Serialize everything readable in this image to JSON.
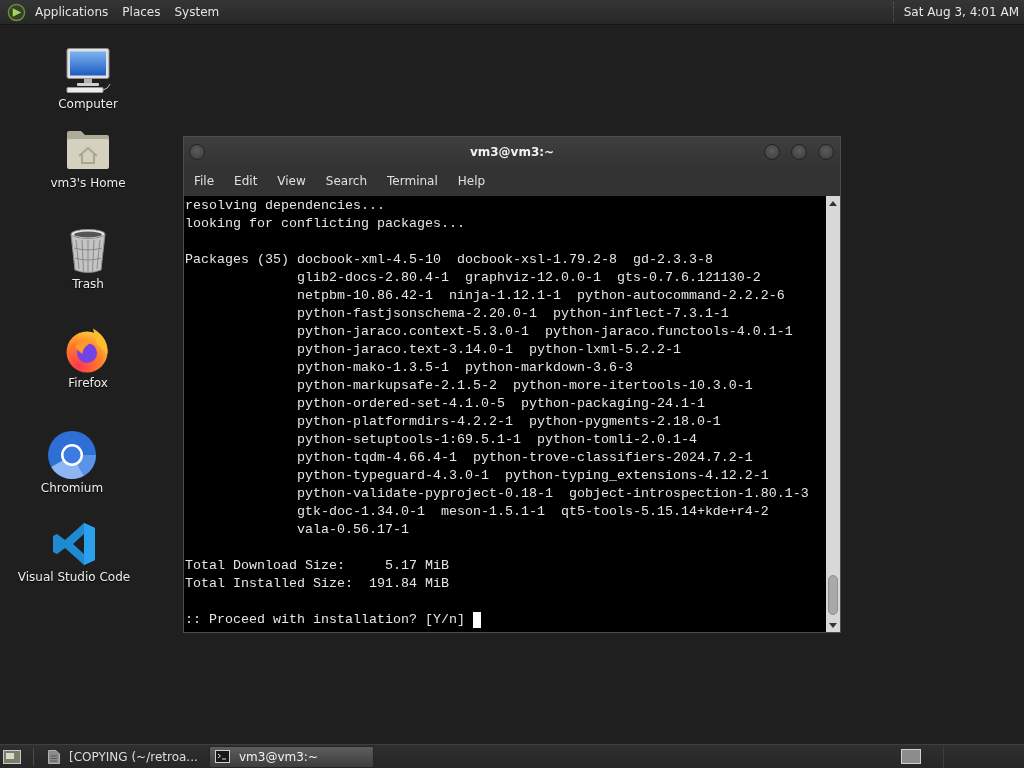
{
  "top_panel": {
    "menus": [
      "Applications",
      "Places",
      "System"
    ],
    "clock": "Sat Aug 3, 4:01 AM"
  },
  "desktop_icons": [
    {
      "kind": "computer",
      "label": "Computer"
    },
    {
      "kind": "home",
      "label": "vm3's Home"
    },
    {
      "kind": "trash",
      "label": "Trash"
    },
    {
      "kind": "firefox",
      "label": "Firefox"
    },
    {
      "kind": "chromium",
      "label": "Chromium"
    },
    {
      "kind": "vscode",
      "label": "Visual Studio Code"
    }
  ],
  "terminal": {
    "title": "vm3@vm3:~",
    "menu": [
      "File",
      "Edit",
      "View",
      "Search",
      "Terminal",
      "Help"
    ],
    "status_lines": [
      "resolving dependencies...",
      "looking for conflicting packages..."
    ],
    "packages": {
      "label": "Packages (35)",
      "lines": [
        "docbook-xml-4.5-10  docbook-xsl-1.79.2-8  gd-2.3.3-8",
        "glib2-docs-2.80.4-1  graphviz-12.0.0-1  gts-0.7.6.121130-2",
        "netpbm-10.86.42-1  ninja-1.12.1-1  python-autocommand-2.2.2-6",
        "python-fastjsonschema-2.20.0-1  python-inflect-7.3.1-1",
        "python-jaraco.context-5.3.0-1  python-jaraco.functools-4.0.1-1",
        "python-jaraco.text-3.14.0-1  python-lxml-5.2.2-1",
        "python-mako-1.3.5-1  python-markdown-3.6-3",
        "python-markupsafe-2.1.5-2  python-more-itertools-10.3.0-1",
        "python-ordered-set-4.1.0-5  python-packaging-24.1-1",
        "python-platformdirs-4.2.2-1  python-pygments-2.18.0-1",
        "python-setuptools-1:69.5.1-1  python-tomli-2.0.1-4",
        "python-tqdm-4.66.4-1  python-trove-classifiers-2024.7.2-1",
        "python-typeguard-4.3.0-1  python-typing_extensions-4.12.2-1",
        "python-validate-pyproject-0.18-1  gobject-introspection-1.80.1-3",
        "gtk-doc-1.34.0-1  meson-1.5.1-1  qt5-tools-5.15.14+kde+r4-2",
        "vala-0.56.17-1"
      ]
    },
    "totals": [
      {
        "label": "Total Download Size:",
        "value": "5.17 MiB"
      },
      {
        "label": "Total Installed Size:",
        "value": "191.84 MiB"
      }
    ],
    "prompt": ":: Proceed with installation? [Y/n]"
  },
  "taskbar": {
    "tasks": [
      {
        "kind": "file",
        "label": "[COPYING (~/retroa...",
        "selected": false
      },
      {
        "kind": "terminal",
        "label": "vm3@vm3:~",
        "selected": true
      }
    ]
  }
}
